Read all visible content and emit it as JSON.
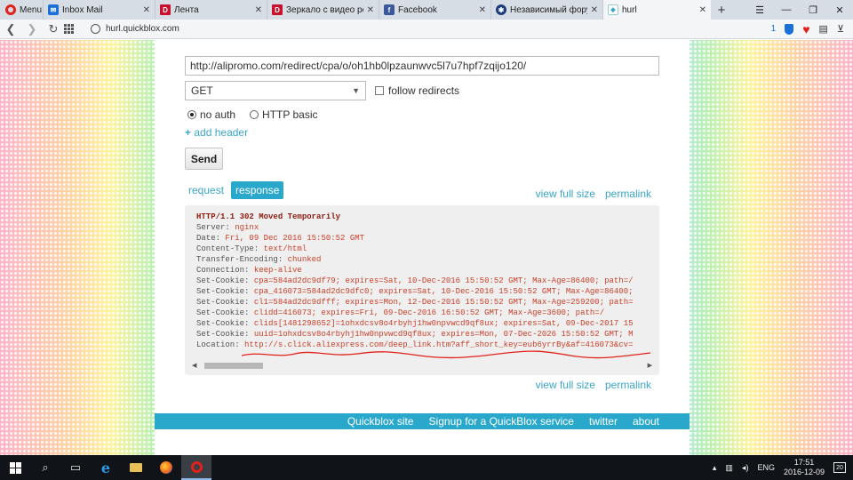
{
  "browser": {
    "menu_label": "Menu",
    "tabs": [
      {
        "label": "Inbox Mail",
        "icon": "mail-icon",
        "active": false
      },
      {
        "label": "Лента",
        "icon": "d-icon",
        "active": false
      },
      {
        "label": "Зеркало с видео регис",
        "icon": "d-icon",
        "active": false
      },
      {
        "label": "Facebook",
        "icon": "facebook-icon",
        "active": false
      },
      {
        "label": "Независимый форум п",
        "icon": "forum-icon",
        "active": false
      },
      {
        "label": "hurl",
        "icon": "hurl-icon",
        "active": true
      }
    ],
    "address": "hurl.quickblox.com",
    "adblock_count": "1"
  },
  "request": {
    "url": "http://alipromo.com/redirect/cpa/o/oh1hb0lpzaunwvc5l7u7hpf7zqijo120/",
    "method": "GET",
    "follow_redirects_label": "follow redirects",
    "follow_redirects_checked": false,
    "auth_options": [
      "no auth",
      "HTTP basic"
    ],
    "auth_selected": "no auth",
    "add_header_plus": "+",
    "add_header_label": "add header",
    "send_label": "Send"
  },
  "response_tabs": {
    "request_label": "request",
    "response_label": "response",
    "active": "response"
  },
  "links": {
    "view_full_size": "view full size",
    "permalink": "permalink"
  },
  "response": {
    "status_line": "HTTP/1.1 302 Moved Temporarily",
    "headers": [
      {
        "key": "Server:",
        "value": "nginx"
      },
      {
        "key": "Date:",
        "value": "Fri, 09 Dec 2016 15:50:52 GMT"
      },
      {
        "key": "Content-Type:",
        "value": "text/html"
      },
      {
        "key": "Transfer-Encoding:",
        "value": "chunked"
      },
      {
        "key": "Connection:",
        "value": "keep-alive"
      },
      {
        "key": "Set-Cookie:",
        "value": "cpa=584ad2dc9df79; expires=Sat, 10-Dec-2016 15:50:52 GMT; Max-Age=86400; path=/"
      },
      {
        "key": "Set-Cookie:",
        "value": "cpa_416073=584ad2dc9dfc0; expires=Sat, 10-Dec-2016 15:50:52 GMT; Max-Age=86400;"
      },
      {
        "key": "Set-Cookie:",
        "value": "cl1=584ad2dc9dfff; expires=Mon, 12-Dec-2016 15:50:52 GMT; Max-Age=259200; path="
      },
      {
        "key": "Set-Cookie:",
        "value": "clidd=416073; expires=Fri, 09-Dec-2016 16:50:52 GMT; Max-Age=3600; path=/"
      },
      {
        "key": "Set-Cookie:",
        "value": "clids[1481298652]=1ohxdcsv8o4rbyhj1hw0npvwcd9qf8ux; expires=Sat, 09-Dec-2017 15"
      },
      {
        "key": "Set-Cookie:",
        "value": "uuid=1ohxdcsv8o4rbyhj1hw0npvwcd9qf8ux; expires=Mon, 07-Dec-2026 15:50:52 GMT; M"
      },
      {
        "key": "Location:",
        "value": "http://s.click.aliexpress.com/deep_link.htm?aff_short_key=eub6yrrBy&af=416073&cv="
      }
    ]
  },
  "footer": {
    "links": [
      "Quickblox site",
      "Signup for a QuickBlox service",
      "twitter",
      "about"
    ]
  },
  "taskbar": {
    "lang": "ENG",
    "time": "17:51",
    "date": "2016-12-09",
    "notifications": "20"
  },
  "colors": {
    "accent": "#2aa8cc",
    "link": "#3aa6c9",
    "header_value": "#c8402a",
    "annotation": "#e0221a"
  }
}
